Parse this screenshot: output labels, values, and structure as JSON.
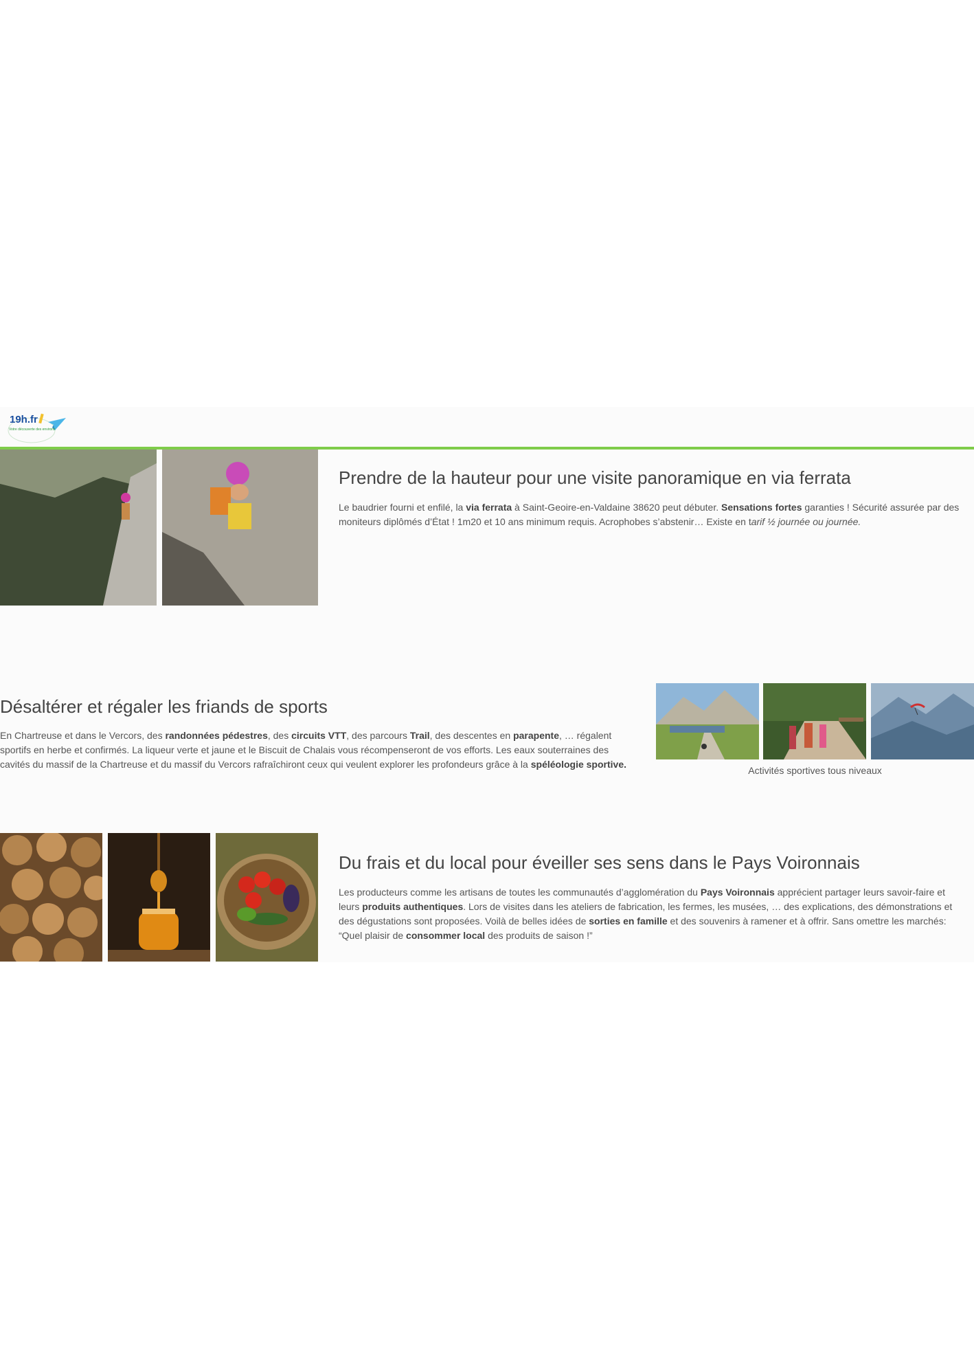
{
  "logo": {
    "text": "19h.fr",
    "tagline": "Votre découverte des environs"
  },
  "section1": {
    "title": "Prendre de la hauteur pour une visite panoramique en via ferrata",
    "p1": "Le baudrier fourni et enfilé,  la ",
    "b1": "via ferrata",
    "p2": " à Saint-Geoire-en-Valdaine 38620 peut débuter. ",
    "b2": "Sensations fortes",
    "p3": " garanties ! Sécurité assurée par des moniteurs diplômés d’État ! 1m20 et 10 ans minimum requis. Acrophobes s’abstenir… Existe en t",
    "i1": "arif ½ journée ou journée."
  },
  "section2": {
    "title": "Désaltérer et régaler les friands de sports",
    "p1": "En Chartreuse et dans le Vercors, des ",
    "b1": "randonnées pédestres",
    "p2": ", des ",
    "b2": "circuits VTT",
    "p3": ", des parcours ",
    "b3": "Trail",
    "p4": ", des descentes en ",
    "b4": "parapente",
    "p5": ", … régalent sportifs en herbe et confirmés. La liqueur verte et jaune et le Biscuit de Chalais vous récompenseront de vos efforts. Les eaux souterraines des cavités du massif de la Chartreuse et du massif du Vercors rafraîchiront ceux qui veulent explorer les profondeurs grâce à la ",
    "b5": "spéléologie sportive.",
    "caption": "Activités sportives tous niveaux"
  },
  "section3": {
    "title": "Du frais et du local pour éveiller ses sens dans le Pays Voironnais",
    "p1": "Les producteurs comme les artisans de toutes les communautés d’agglomération du ",
    "b1": "Pays Voironnais",
    "p2": " apprécient partager leurs savoir-faire et leurs ",
    "b2": "produits authentiques",
    "p3": ". Lors de visites dans les ateliers de fabrication, les fermes, les musées, … des explications, des démonstrations et des dégustations sont proposées. Voilà de belles idées de ",
    "b3": "sorties en famille",
    "p4": " et des souvenirs à ramener et à offrir. Sans omettre les marchés: “Quel plaisir de ",
    "b4": "consommer local",
    "p5": " des produits de saison !”"
  },
  "colors": {
    "accent_line": "#7fcc4a",
    "logo_blue": "#1a4fa0",
    "text": "#555555"
  }
}
